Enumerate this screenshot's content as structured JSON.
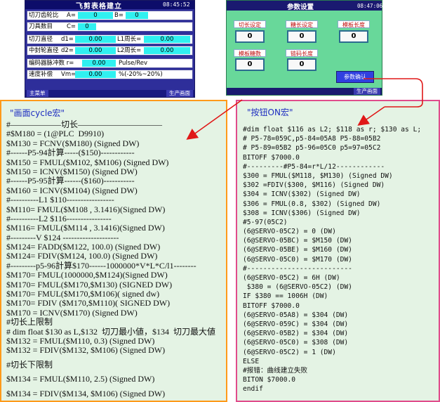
{
  "screen1": {
    "title": "飞剪表格建立",
    "time": "08:45:52",
    "rows": [
      {
        "label": "切刀齿轮比",
        "items": [
          {
            "l": "A=",
            "v": "0"
          },
          {
            "l": "B=",
            "v": "0"
          }
        ]
      },
      {
        "label": "刀具数目",
        "items": [
          {
            "l": "C=",
            "v": "0"
          }
        ]
      },
      {
        "label": "切刀直径",
        "items": [
          {
            "l": "d1=",
            "v": "0.00"
          },
          {
            "l": "L1周长=",
            "v": "0.00"
          }
        ]
      },
      {
        "label": "中封轮直径",
        "items": [
          {
            "l": "d2=",
            "v": "0.00"
          },
          {
            "l": "L2周长=",
            "v": "0.00"
          }
        ]
      },
      {
        "label": "编码器脉冲数 r=",
        "value": "0.00",
        "unit": "Pulse/Rev"
      },
      {
        "label": "速度补偿",
        "sub": "Vm=",
        "value": "0.00",
        "unit": "%(-20%~20%)"
      }
    ],
    "footer_left": "主菜单",
    "footer_right": "生产画面"
  },
  "screen2": {
    "title": "参数设置",
    "time": "08:47:06",
    "labels": [
      "切长设定",
      "糖长设定",
      "模板长度",
      "模板糖数",
      "链码长度"
    ],
    "values": [
      "0",
      "0",
      "0",
      "0",
      "0"
    ],
    "confirm": "参数确认",
    "footer_right": "生产画面"
  },
  "left_panel": {
    "title": "\"画面cycle宏\"",
    "lines": [
      "#——————切长——————————",
      "#$M180 = (1@PLC  D9910)",
      "$M130 = FCNV($M180) (Signed DW)",
      "#------P5-94計算-----($150)------------",
      "$M150 = FMUL($M102, $M106) (Signed DW)",
      "$M150 = ICNV($M150) (Signed DW)",
      "#------P5-95計算------($160)-----------",
      "$M160 = ICNV($M104) (Signed DW)",
      "#----------L1 $110-----------------",
      "$M110= FMUL($M108 , 3.1416)(Signed DW)",
      "#----------L2 $116----------------",
      "$M116= FMUL($M114 , 3.1416)(Signed DW)",
      "#---------V $124 --------------------",
      "$M124= FADD($M122, 100.0) (Signed DW)",
      "$M124= FDIV($M124, 100.0) (Signed DW)",
      "#---------p5-96計算$170------1000000*V*L*C/l1--------",
      "$M170= FMUL(1000000,$M124)(Signed DW)",
      "$M170= FMUL($M170,$M130) (SIGNED DW)",
      "$M170= FMUL($M170,$M106)( signed dw)",
      "$M170= FDIV ($M170,$M110)( SIGNED DW)",
      "$M170 = ICNV($M170) (Signed DW)",
      "#切长上限制",
      "# dim float $130 as L,$132  切刀最小値，$134  切刀最大値",
      "$M132 = FMUL($M110, 0.3) (Signed DW)",
      "$M132 = FDIV($M132, $M106) (Signed DW)",
      "",
      "#切长下限制",
      "",
      "$M134 = FMUL($M110, 2.5) (Signed DW)",
      "",
      "$M134 = FDIV($M134, $M106) (Signed DW)"
    ]
  },
  "right_panel": {
    "title": "\"按钮ON宏\"",
    "lines": [
      "#dim float $116 as L2; $118 as r; $130 as L;",
      "# P5-78=059C,p5-84=05A8 P5-88=05B2",
      "# P5-89=05B2 p5-96=05C0 p5=97=05C2",
      "BITOFF $7000.0",
      "#---------#P5-84=r*L/12------------",
      "$300 = FMUL($M118, $M130) (Signed DW)",
      "$302 =FDIV($300, $M116) (Signed DW)",
      "$304 = ICNV($302) (Signed DW)",
      "$306 = FMUL(0.8, $302) (Signed DW)",
      "$308 = ICNV($306) (Signed DW)",
      "#5-97(05C2)",
      "(6@SERVO-05C2) = 0 (DW)",
      "(6@SERVO-05BC) = $M150 (DW)",
      "(6@SERVO-05BE) = $M160 (DW)",
      "(6@SERVO-05C0) = $M170 (DW)",
      "#--------------------------",
      "(6@SERVO-05C2) = 6H (DW)",
      " $380 = (6@SERVO-05C2) (DW)",
      "IF $380 == 1006H (DW)",
      "BITOFF $7000.0",
      "(6@SERVO-05A8) = $304 (DW)",
      "(6@SERVO-059C) = $304 (DW)",
      "(6@SERVO-05B2) = $304 (DW)",
      "(6@SERVO-05C0) = $308 (DW)",
      "(6@SERVO-05C2) = 1 (DW)",
      "ELSE",
      "#报错：曲线建立失败",
      "BITON $7000.0",
      "endif"
    ]
  },
  "colors": {
    "left_border": "#ff9a1a",
    "right_border": "#e04c8c",
    "panel_bg": "#e4f3e4",
    "panel_title": "#1d2dc0",
    "arrow": "#e01818",
    "screen1_bg": "#2e2e9a",
    "screen2_bg": "#68d89a",
    "value_cyan": "#30f0f0"
  }
}
